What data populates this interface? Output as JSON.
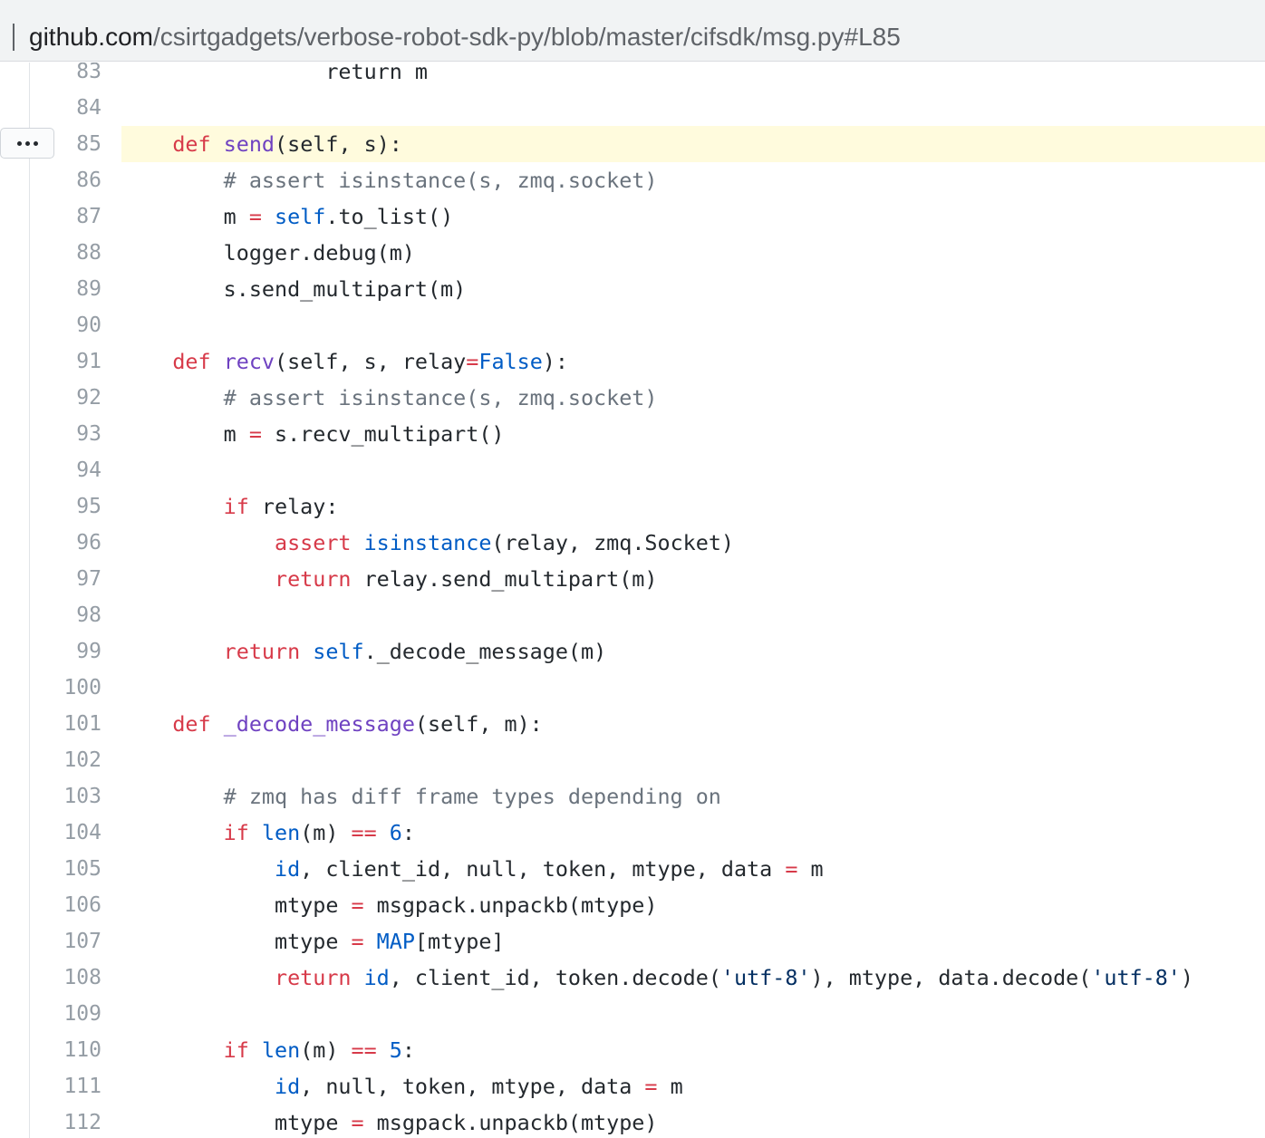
{
  "address_bar": {
    "host": "github.com",
    "path": "/csirtgadgets/verbose-robot-sdk-py/blob/master/cifsdk/msg.py#L85"
  },
  "code_view": {
    "highlighted_line": "85",
    "more_button_label": "...",
    "lines": [
      {
        "n": "83",
        "tokens": [
          [
            "",
            "                return m"
          ]
        ]
      },
      {
        "n": "84",
        "tokens": []
      },
      {
        "n": "85",
        "tokens": [
          [
            "",
            "    "
          ],
          [
            "kw",
            "def"
          ],
          [
            "",
            " "
          ],
          [
            "fn",
            "send"
          ],
          [
            "",
            "(self, s):"
          ]
        ]
      },
      {
        "n": "86",
        "tokens": [
          [
            "",
            "        "
          ],
          [
            "cm",
            "# assert isinstance(s, zmq.socket)"
          ]
        ]
      },
      {
        "n": "87",
        "tokens": [
          [
            "",
            "        m "
          ],
          [
            "op",
            "="
          ],
          [
            "",
            " "
          ],
          [
            "bi",
            "self"
          ],
          [
            "",
            ".to_list()"
          ]
        ]
      },
      {
        "n": "88",
        "tokens": [
          [
            "",
            "        logger.debug(m)"
          ]
        ]
      },
      {
        "n": "89",
        "tokens": [
          [
            "",
            "        s.send_multipart(m)"
          ]
        ]
      },
      {
        "n": "90",
        "tokens": []
      },
      {
        "n": "91",
        "tokens": [
          [
            "",
            "    "
          ],
          [
            "kw",
            "def"
          ],
          [
            "",
            " "
          ],
          [
            "fn",
            "recv"
          ],
          [
            "",
            "(self, s, relay"
          ],
          [
            "op",
            "="
          ],
          [
            "bi",
            "False"
          ],
          [
            "",
            "):"
          ]
        ]
      },
      {
        "n": "92",
        "tokens": [
          [
            "",
            "        "
          ],
          [
            "cm",
            "# assert isinstance(s, zmq.socket)"
          ]
        ]
      },
      {
        "n": "93",
        "tokens": [
          [
            "",
            "        m "
          ],
          [
            "op",
            "="
          ],
          [
            "",
            " s.recv_multipart()"
          ]
        ]
      },
      {
        "n": "94",
        "tokens": []
      },
      {
        "n": "95",
        "tokens": [
          [
            "",
            "        "
          ],
          [
            "kw",
            "if"
          ],
          [
            "",
            " relay:"
          ]
        ]
      },
      {
        "n": "96",
        "tokens": [
          [
            "",
            "            "
          ],
          [
            "kw",
            "assert"
          ],
          [
            "",
            " "
          ],
          [
            "bi",
            "isinstance"
          ],
          [
            "",
            "(relay, zmq.Socket)"
          ]
        ]
      },
      {
        "n": "97",
        "tokens": [
          [
            "",
            "            "
          ],
          [
            "kw",
            "return"
          ],
          [
            "",
            " relay.send_multipart(m)"
          ]
        ]
      },
      {
        "n": "98",
        "tokens": []
      },
      {
        "n": "99",
        "tokens": [
          [
            "",
            "        "
          ],
          [
            "kw",
            "return"
          ],
          [
            "",
            " "
          ],
          [
            "bi",
            "self"
          ],
          [
            "",
            "._decode_message(m)"
          ]
        ]
      },
      {
        "n": "100",
        "tokens": []
      },
      {
        "n": "101",
        "tokens": [
          [
            "",
            "    "
          ],
          [
            "kw",
            "def"
          ],
          [
            "",
            " "
          ],
          [
            "fn",
            "_decode_message"
          ],
          [
            "",
            "(self, m):"
          ]
        ]
      },
      {
        "n": "102",
        "tokens": []
      },
      {
        "n": "103",
        "tokens": [
          [
            "",
            "        "
          ],
          [
            "cm",
            "# zmq has diff frame types depending on"
          ]
        ]
      },
      {
        "n": "104",
        "tokens": [
          [
            "",
            "        "
          ],
          [
            "kw",
            "if"
          ],
          [
            "",
            " "
          ],
          [
            "bi",
            "len"
          ],
          [
            "",
            "(m) "
          ],
          [
            "op",
            "=="
          ],
          [
            "",
            " "
          ],
          [
            "bi",
            "6"
          ],
          [
            "",
            ":"
          ]
        ]
      },
      {
        "n": "105",
        "tokens": [
          [
            "",
            "            "
          ],
          [
            "bi",
            "id"
          ],
          [
            "",
            ", client_id, null, token, mtype, data "
          ],
          [
            "op",
            "="
          ],
          [
            "",
            " m"
          ]
        ]
      },
      {
        "n": "106",
        "tokens": [
          [
            "",
            "            mtype "
          ],
          [
            "op",
            "="
          ],
          [
            "",
            " msgpack.unpackb(mtype)"
          ]
        ]
      },
      {
        "n": "107",
        "tokens": [
          [
            "",
            "            mtype "
          ],
          [
            "op",
            "="
          ],
          [
            "",
            " "
          ],
          [
            "bi",
            "MAP"
          ],
          [
            "",
            "[mtype]"
          ]
        ]
      },
      {
        "n": "108",
        "tokens": [
          [
            "",
            "            "
          ],
          [
            "kw",
            "return"
          ],
          [
            "",
            " "
          ],
          [
            "bi",
            "id"
          ],
          [
            "",
            ", client_id, token.decode("
          ],
          [
            "st",
            "'utf-8'"
          ],
          [
            "",
            "), mtype, data.decode("
          ],
          [
            "st",
            "'utf-8'"
          ],
          [
            "",
            ")"
          ]
        ]
      },
      {
        "n": "109",
        "tokens": []
      },
      {
        "n": "110",
        "tokens": [
          [
            "",
            "        "
          ],
          [
            "kw",
            "if"
          ],
          [
            "",
            " "
          ],
          [
            "bi",
            "len"
          ],
          [
            "",
            "(m) "
          ],
          [
            "op",
            "=="
          ],
          [
            "",
            " "
          ],
          [
            "bi",
            "5"
          ],
          [
            "",
            ":"
          ]
        ]
      },
      {
        "n": "111",
        "tokens": [
          [
            "",
            "            "
          ],
          [
            "bi",
            "id"
          ],
          [
            "",
            ", null, token, mtype, data "
          ],
          [
            "op",
            "="
          ],
          [
            "",
            " m"
          ]
        ]
      },
      {
        "n": "112",
        "tokens": [
          [
            "",
            "            mtype "
          ],
          [
            "op",
            "="
          ],
          [
            "",
            " msgpack.unpackb(mtype)"
          ]
        ]
      }
    ]
  },
  "colors": {
    "keyword": "#d73a49",
    "function": "#6f42c1",
    "builtin": "#005cc5",
    "comment": "#6a737d",
    "string": "#032f62",
    "highlight": "#fffbdd"
  }
}
